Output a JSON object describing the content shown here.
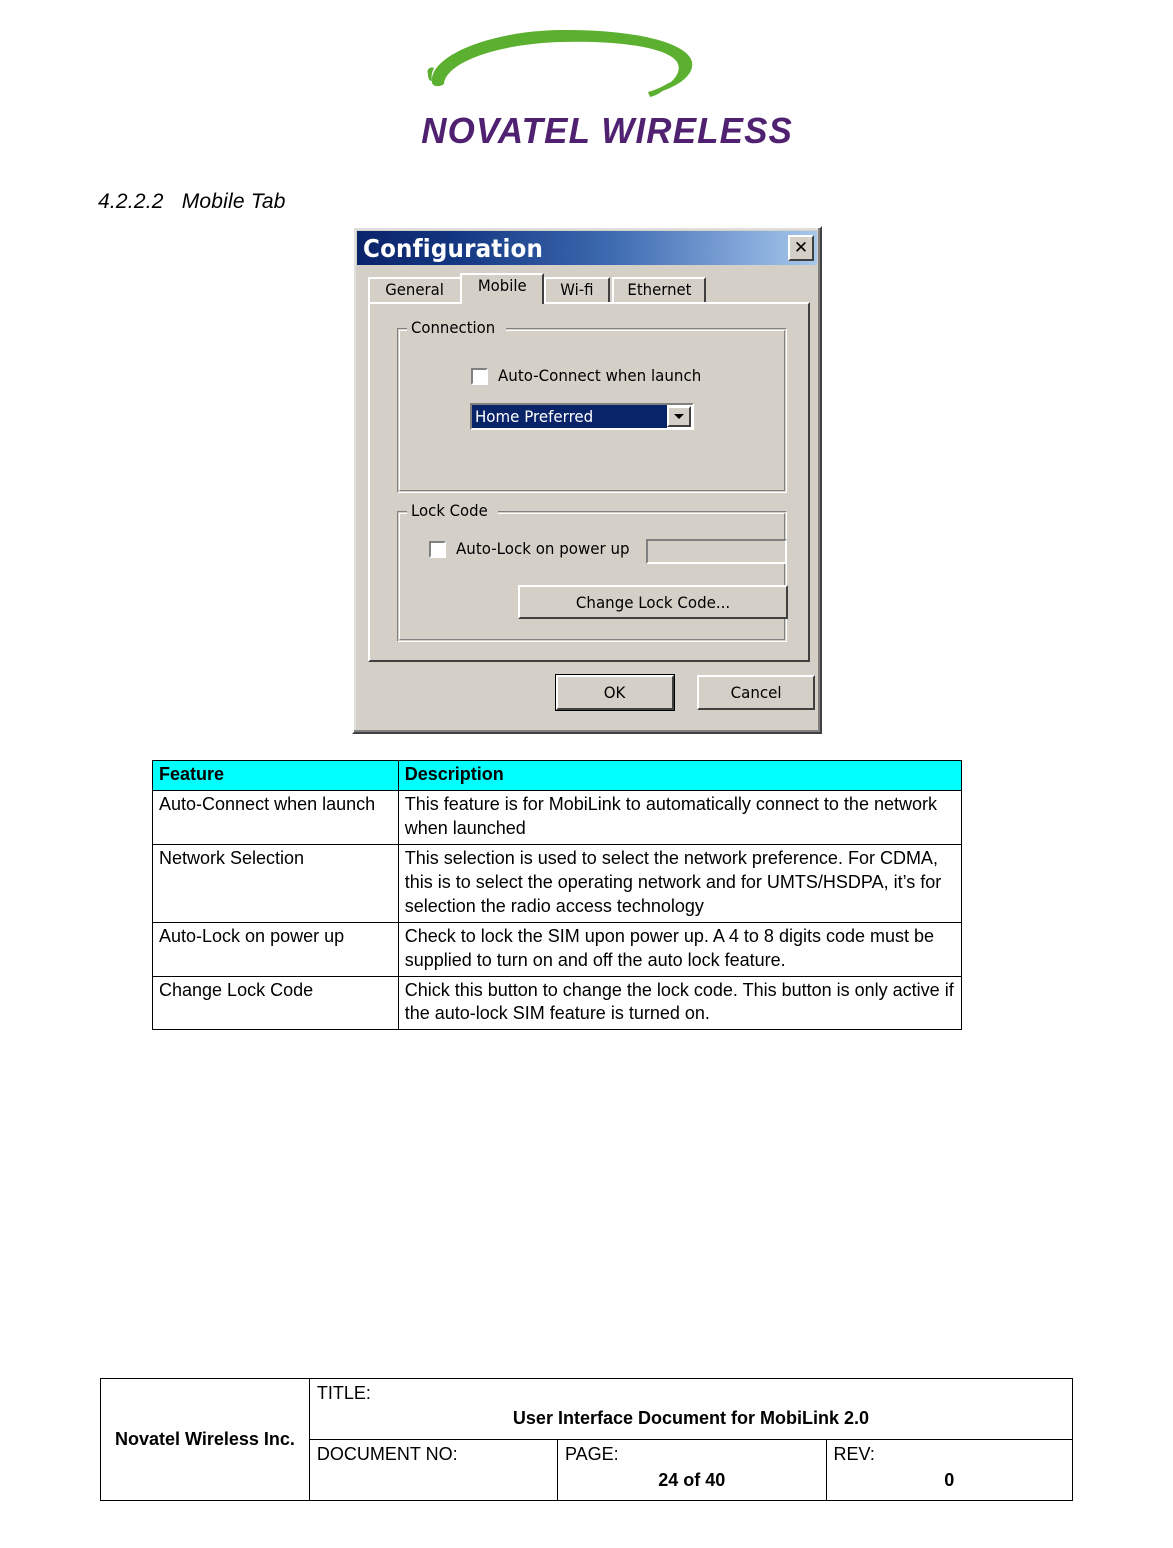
{
  "brand": {
    "logo_wordmark": "NOVATEL WIRELESS",
    "logo_swoosh_color": "#5cb030",
    "logo_text_color": "#4f2170"
  },
  "section": {
    "number": "4.2.2.2",
    "title": "Mobile Tab",
    "heading": "4.2.2.2   Mobile Tab"
  },
  "dialog": {
    "title": "Configuration",
    "close_label": "✕",
    "tabs": [
      {
        "label": "General",
        "selected": false
      },
      {
        "label": "Mobile",
        "selected": true
      },
      {
        "label": "Wi-fi",
        "selected": false
      },
      {
        "label": "Ethernet",
        "selected": false
      }
    ],
    "connection_group": {
      "title": "Connection",
      "auto_connect_label": "Auto-Connect when launch",
      "auto_connect_checked": false,
      "network_selection_value": "Home Preferred",
      "network_selection_options": [
        "Home Preferred"
      ]
    },
    "lock_group": {
      "title": "Lock Code",
      "auto_lock_label": "Auto-Lock on power up",
      "auto_lock_checked": false,
      "lock_code_value": "",
      "lock_code_placeholder": "",
      "change_button_label": "Change Lock Code..."
    },
    "ok_label": "OK",
    "cancel_label": "Cancel",
    "colors": {
      "face": "#d4d0c8",
      "titlebar_start": "#0a246a",
      "titlebar_end": "#a6c8ea",
      "selection": "#0a246a"
    }
  },
  "feature_table": {
    "headers": [
      "Feature",
      "Description"
    ],
    "header_background": "#00ffff",
    "rows": [
      {
        "feature": "Auto-Connect when launch",
        "description": "This feature is for MobiLink to automatically connect to the network when launched"
      },
      {
        "feature": "Network Selection",
        "description": "This selection is used to select the network preference.  For CDMA, this is to select the operating network and for UMTS/HSDPA, it’s for selection the radio access technology"
      },
      {
        "feature": "Auto-Lock on power up",
        "description": "Check to lock the SIM upon power up.  A 4 to 8 digits code must be supplied to turn on and off the auto lock feature."
      },
      {
        "feature": "Change Lock Code",
        "description": "Chick this button to change the lock code.  This button is only active if the auto-lock SIM feature is turned on."
      }
    ]
  },
  "footer": {
    "company": "Novatel Wireless Inc.",
    "title_label": "TITLE:",
    "title_value": "User Interface Document for MobiLink 2.0",
    "document_no_label": "DOCUMENT NO:",
    "document_no_value": "",
    "page_label": "PAGE:",
    "page_value": "24 of 40",
    "rev_label": "REV:",
    "rev_value": "0"
  }
}
